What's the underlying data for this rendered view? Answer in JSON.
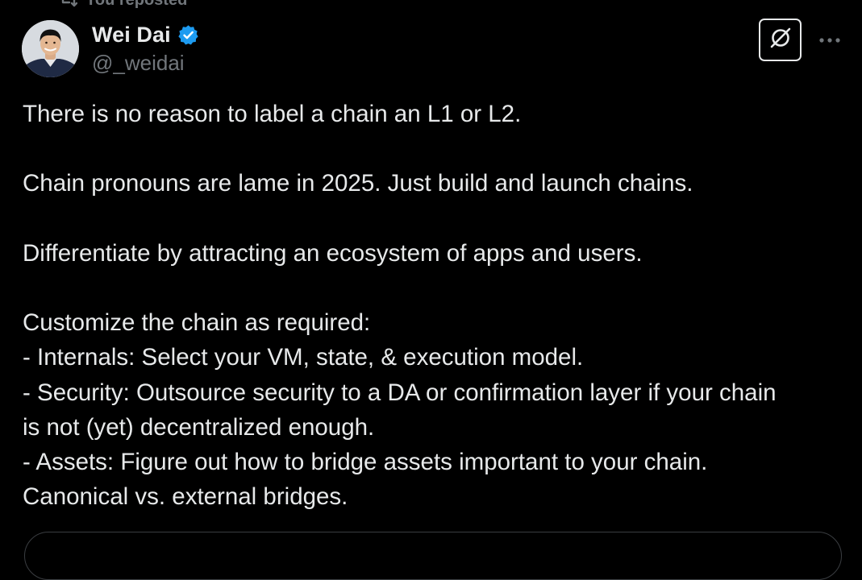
{
  "repost": {
    "label": "You reposted"
  },
  "author": {
    "display_name": "Wei Dai",
    "handle": "@_weidai",
    "verified": true
  },
  "icons": {
    "repost": "repost-icon",
    "verified": "verified-badge-icon",
    "grok": "grok-icon",
    "more": "more-dots-icon"
  },
  "colors": {
    "background": "#000000",
    "text_primary": "#e7e9ea",
    "text_secondary": "#71767b",
    "verified_blue": "#1d9bf0"
  },
  "tweet": {
    "paragraphs": [
      "There is no reason to label a chain an L1 or L2.",
      "Chain pronouns are lame in 2025. Just build and launch chains.",
      "Differentiate by attracting an ecosystem of apps and users."
    ],
    "list_intro": "Customize the chain as required:",
    "lines": [
      "- Internals: Select your VM, state, & execution model.",
      "- Security: Outsource security to a DA or confirmation layer if your chain",
      "is not (yet) decentralized enough.",
      "- Assets: Figure out how to bridge assets important to your chain.",
      "Canonical vs. external bridges."
    ]
  }
}
